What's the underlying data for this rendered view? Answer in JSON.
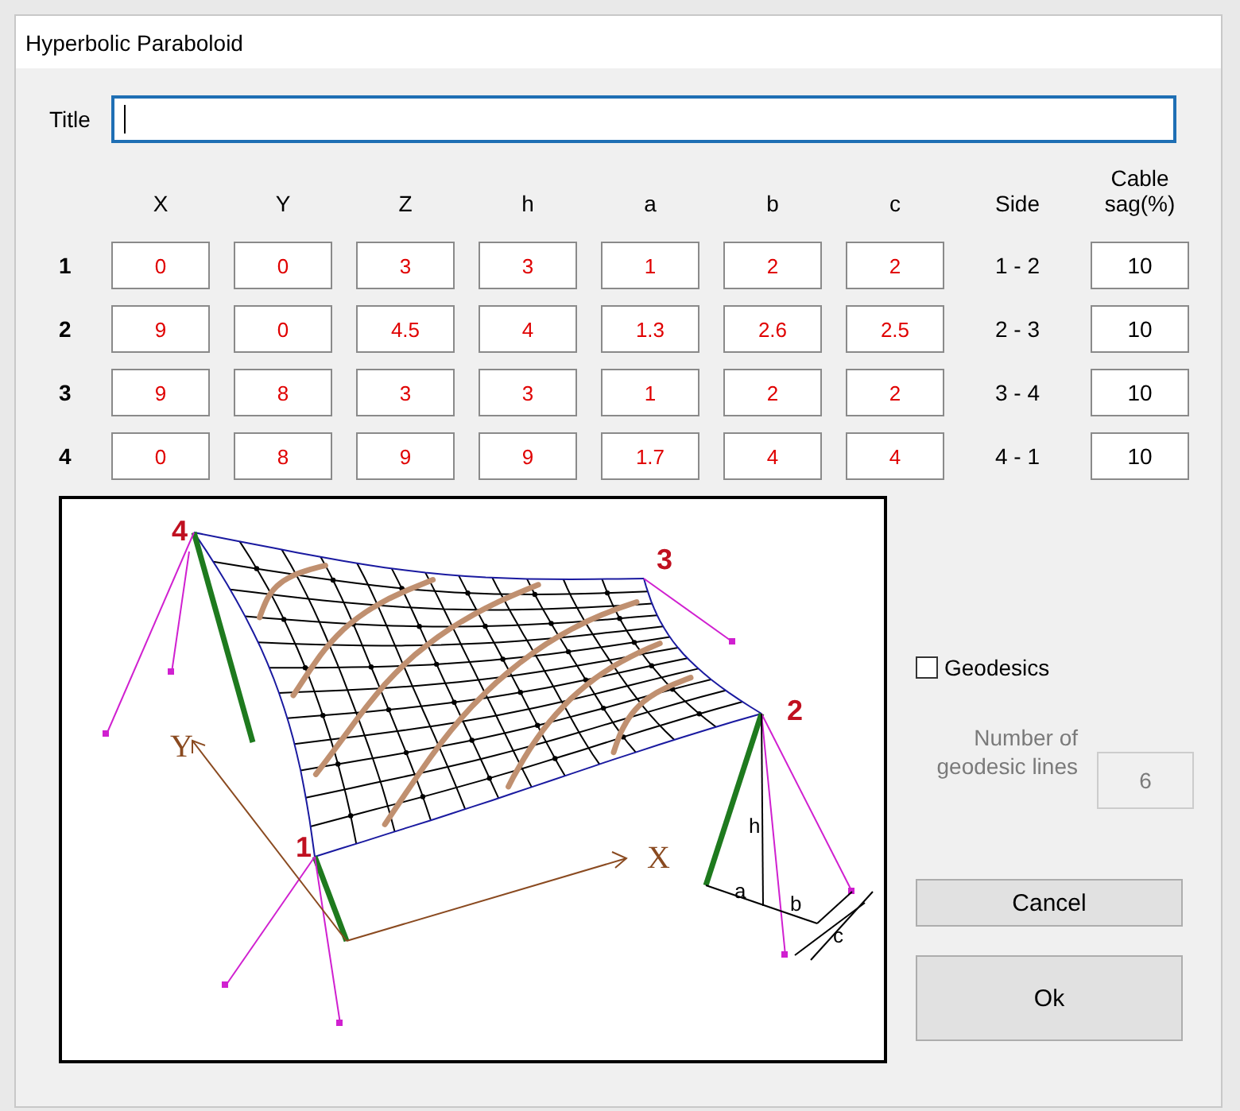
{
  "window": {
    "title": "Hyperbolic Paraboloid"
  },
  "title_field": {
    "label": "Title",
    "focused": true
  },
  "table": {
    "columns": [
      "X",
      "Y",
      "Z",
      "h",
      "a",
      "b",
      "c"
    ],
    "side_header": "Side",
    "cable_header": "Cable sag(%)",
    "rows": [
      {
        "label": "1",
        "values": [
          "0",
          "0",
          "3",
          "3",
          "1",
          "2",
          "2"
        ],
        "side": "1 - 2",
        "cable_sag": "10"
      },
      {
        "label": "2",
        "values": [
          "9",
          "0",
          "4.5",
          "4",
          "1.3",
          "2.6",
          "2.5"
        ],
        "side": "2 - 3",
        "cable_sag": "10"
      },
      {
        "label": "3",
        "values": [
          "9",
          "8",
          "3",
          "3",
          "1",
          "2",
          "2"
        ],
        "side": "3 - 4",
        "cable_sag": "10"
      },
      {
        "label": "4",
        "values": [
          "0",
          "8",
          "9",
          "9",
          "1.7",
          "4",
          "4"
        ],
        "side": "4 - 1",
        "cable_sag": "10"
      }
    ]
  },
  "diagram": {
    "point_labels": [
      "1",
      "2",
      "3",
      "4"
    ],
    "axis_labels": [
      "X",
      "Y"
    ],
    "dimension_labels": [
      "h",
      "a",
      "b",
      "c"
    ]
  },
  "geodesics": {
    "label": "Geodesics",
    "checked": false
  },
  "geodesic_lines": {
    "label": "Number of geodesic lines",
    "value": "6",
    "disabled": true
  },
  "buttons": [
    {
      "label": "Cancel",
      "kind": "small"
    },
    {
      "label": "Ok",
      "kind": "large"
    }
  ]
}
